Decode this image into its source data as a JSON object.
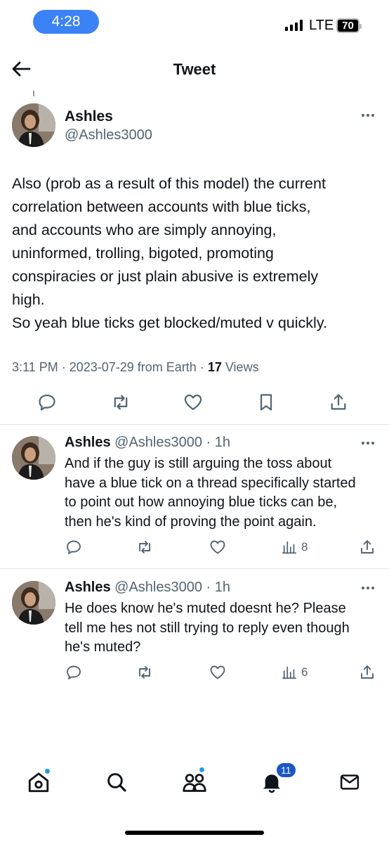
{
  "status_bar": {
    "time": "4:28",
    "network": "LTE",
    "battery": "70"
  },
  "header": {
    "title": "Tweet"
  },
  "main_tweet": {
    "name": "Ashles",
    "handle": "@Ashles3000",
    "body_lines": [
      "Also (prob as a result of this model) the current",
      "correlation between accounts with blue ticks,",
      "and accounts who are simply annoying,",
      "uninformed, trolling, bigoted, promoting",
      "conspiracies or just plain abusive is extremely",
      "high.",
      "So yeah blue ticks get blocked/muted v quickly."
    ],
    "time": "3:11 PM",
    "date": "2023-07-29",
    "source": "from Earth",
    "views_count": "17",
    "views_label": "Views"
  },
  "replies": [
    {
      "name": "Ashles",
      "handle": "@Ashles3000",
      "time": "1h",
      "lines": [
        "And if the guy is still arguing the toss about",
        "have a blue tick on a thread specifically started",
        "to point out how annoying blue ticks can be,",
        "then he's kind of proving the point again."
      ],
      "views": "8"
    },
    {
      "name": "Ashles",
      "handle": "@Ashles3000",
      "time": "1h",
      "lines": [
        "He does know he's muted doesnt he? Please",
        "tell me hes not still trying to reply even though",
        "he's muted?"
      ],
      "views": "6"
    }
  ],
  "bottom_nav": {
    "notifications_badge": "11"
  },
  "icons": [
    "back-arrow-icon",
    "more-icon",
    "reply-icon",
    "retweet-icon",
    "like-icon",
    "bookmark-icon",
    "share-icon",
    "views-icon",
    "home-icon",
    "search-icon",
    "communities-icon",
    "notifications-icon",
    "messages-icon"
  ],
  "colors": {
    "accent": "#1d9bf0",
    "time_pill": "#3b82f6",
    "secondary_text": "#536471",
    "badge": "#1a56c4"
  }
}
